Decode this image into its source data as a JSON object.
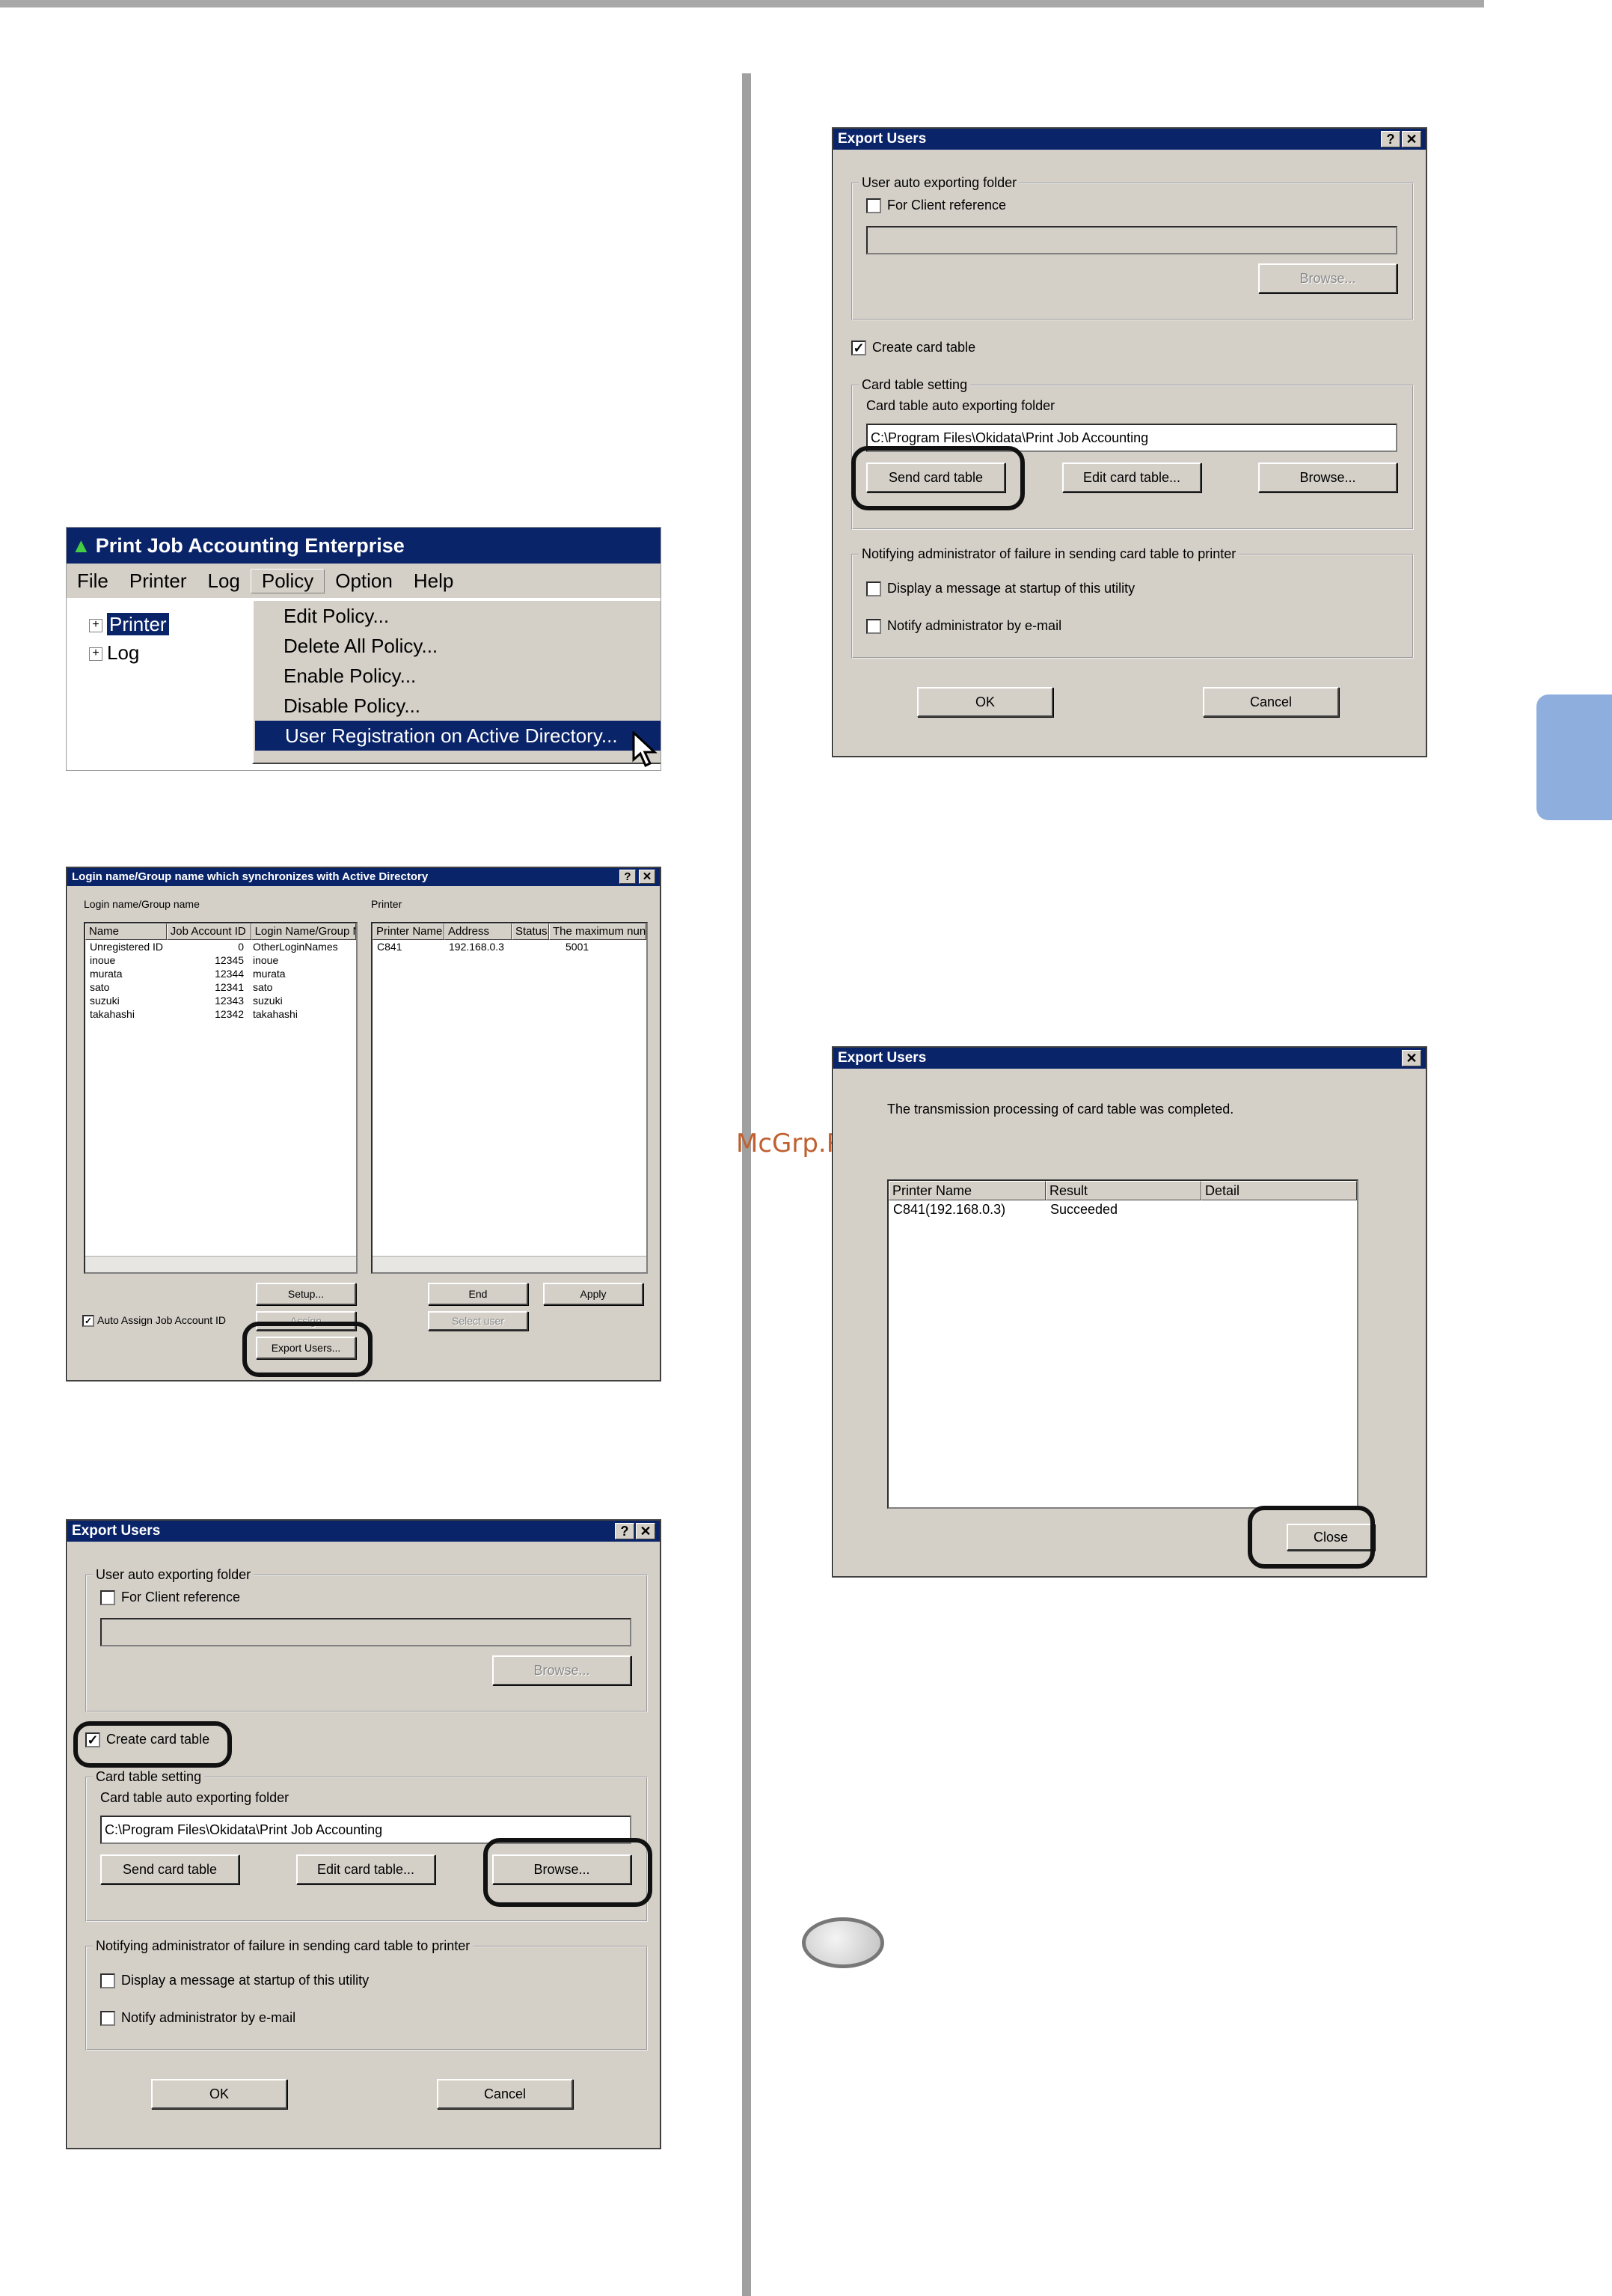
{
  "watermark": "McGrp.Ru",
  "menu_window": {
    "title": "Print Job Accounting Enterprise",
    "menubar": [
      "File",
      "Printer",
      "Log",
      "Policy",
      "Option",
      "Help"
    ],
    "tree": [
      "Printer",
      "Log"
    ],
    "dropdown": [
      "Edit Policy...",
      "Delete All Policy...",
      "Enable Policy...",
      "Disable Policy...",
      "User Registration on Active Directory..."
    ]
  },
  "ad_dialog": {
    "title": "Login name/Group name which synchronizes with Active Directory",
    "login_label": "Login name/Group name",
    "printer_label": "Printer",
    "user_columns": [
      "Name",
      "Job Account ID",
      "Login Name/Group N"
    ],
    "users": [
      [
        "Unregistered ID",
        "0",
        "OtherLoginNames"
      ],
      [
        "inoue",
        "12345",
        "inoue"
      ],
      [
        "murata",
        "12344",
        "murata"
      ],
      [
        "sato",
        "12341",
        "sato"
      ],
      [
        "suzuki",
        "12343",
        "suzuki"
      ],
      [
        "takahashi",
        "12342",
        "takahashi"
      ]
    ],
    "printer_columns": [
      "Printer Name",
      "Address",
      "Status",
      "The maximum nun"
    ],
    "printers": [
      [
        "C841",
        "192.168.0.3",
        "",
        "5001"
      ]
    ],
    "setup_btn": "Setup...",
    "end_btn": "End",
    "apply_btn": "Apply",
    "auto_assign": "Auto Assign Job Account ID",
    "assign_btn": "Assign",
    "select_user_btn": "Select user",
    "export_btn": "Export Users..."
  },
  "export_dialog": {
    "title": "Export Users",
    "help": "?",
    "close": "✕",
    "auto_folder_group": "User auto exporting folder",
    "for_client": "For Client reference",
    "browse": "Browse...",
    "create_card": "Create card table",
    "card_setting_group": "Card table setting",
    "card_folder_label": "Card table auto exporting folder",
    "card_path": "C:\\Program Files\\Okidata\\Print Job Accounting",
    "send_btn": "Send card table",
    "edit_btn": "Edit card table...",
    "notify_group": "Notifying administrator of failure in sending card table to printer",
    "display_msg": "Display a message at startup of this utility",
    "notify_email": "Notify administrator by e-mail",
    "ok": "OK",
    "cancel": "Cancel",
    "check_mark": "✓"
  },
  "result_dialog": {
    "title": "Export Users",
    "message": "The transmission processing of card table was completed.",
    "columns": [
      "Printer Name",
      "Result",
      "Detail"
    ],
    "rows": [
      [
        "C841(192.168.0.3)",
        "Succeeded",
        ""
      ]
    ],
    "close_btn": "Close"
  }
}
